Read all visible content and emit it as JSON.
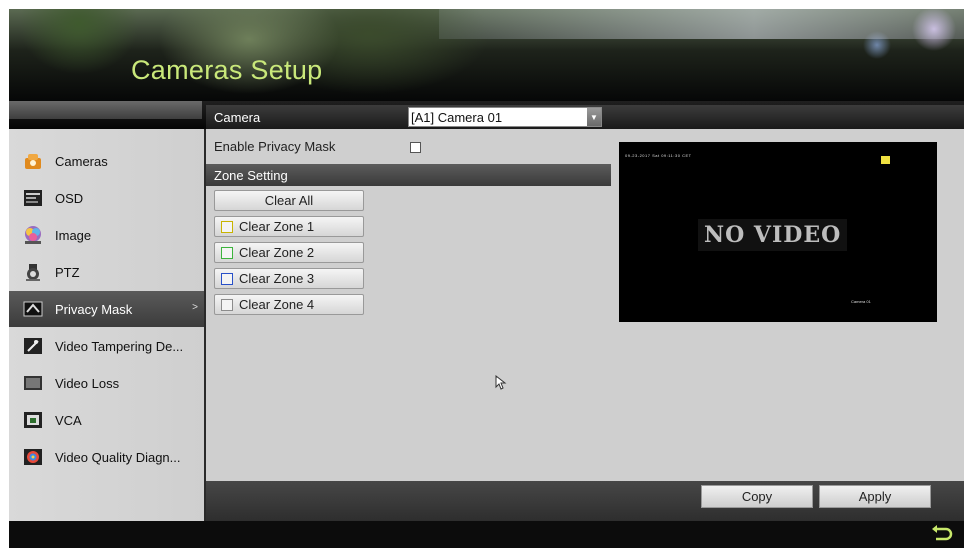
{
  "app": {
    "title": "Cameras Setup"
  },
  "sidebar": {
    "items": [
      {
        "label": "Cameras",
        "icon": "camera-icon",
        "active": false
      },
      {
        "label": "OSD",
        "icon": "osd-icon",
        "active": false
      },
      {
        "label": "Image",
        "icon": "image-icon",
        "active": false
      },
      {
        "label": "PTZ",
        "icon": "ptz-icon",
        "active": false
      },
      {
        "label": "Privacy Mask",
        "icon": "privacy-mask-icon",
        "active": true,
        "arrow": ">"
      },
      {
        "label": "Video Tampering De...",
        "icon": "video-tampering-icon",
        "active": false
      },
      {
        "label": "Video Loss",
        "icon": "video-loss-icon",
        "active": false
      },
      {
        "label": "VCA",
        "icon": "vca-icon",
        "active": false
      },
      {
        "label": "Video Quality Diagn...",
        "icon": "video-quality-icon",
        "active": false
      }
    ]
  },
  "main": {
    "camera_label": "Camera",
    "camera_value": "[A1] Camera 01",
    "privacy_mask_label": "Enable Privacy Mask",
    "privacy_mask_checked": false,
    "zone_setting_title": "Zone Setting",
    "clear_all_label": "Clear All",
    "zones": [
      {
        "label": "Clear Zone 1",
        "color": "#c8b400"
      },
      {
        "label": "Clear Zone 2",
        "color": "#3cb43c"
      },
      {
        "label": "Clear Zone 3",
        "color": "#2850c8"
      },
      {
        "label": "Clear Zone 4",
        "color": "#8c8c8c"
      }
    ],
    "preview": {
      "no_video_text": "NO VIDEO",
      "timestamp": "09-23-2017 Sat 09:11:30 CET",
      "camera_name": "Camera 01"
    }
  },
  "footer": {
    "copy_label": "Copy",
    "apply_label": "Apply"
  },
  "colors": {
    "title": "#c9e87a",
    "active_item": "#4a4a4a",
    "panel_bg": "#cfcfcf"
  }
}
